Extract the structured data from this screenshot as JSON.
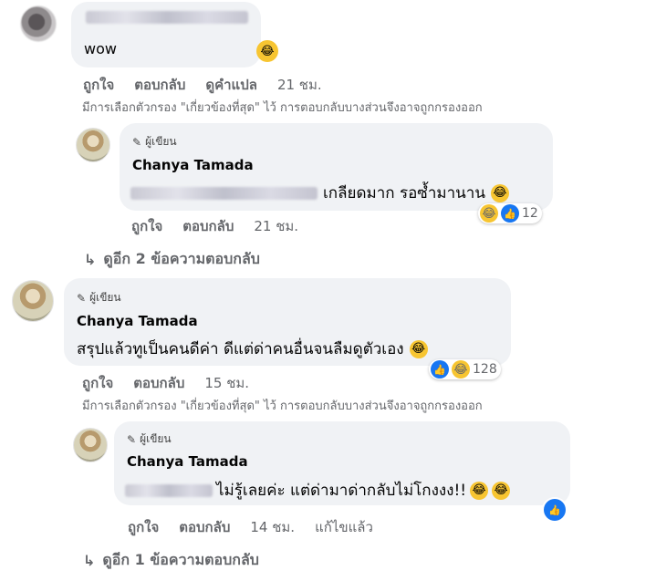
{
  "comment1": {
    "text": "wow",
    "emoji": "laugh-tears-emoji",
    "actions": {
      "like": "ถูกใจ",
      "reply": "ตอบกลับ",
      "translate": "ดูคำแปล",
      "time": "21 ชม."
    },
    "filter_note": "มีการเลือกตัวกรอง \"เกี่ยวข้องที่สุด\" ไว้ การตอบกลับบางส่วนจึงอาจถูกกรองออก"
  },
  "reply1": {
    "badge": "ผู้เขียน",
    "name": "Chanya Tamada",
    "text": "เกลียดมาก รอซ้ำมานาน",
    "actions": {
      "like": "ถูกใจ",
      "reply": "ตอบกลับ",
      "time": "21 ชม."
    },
    "reaction_count": "12"
  },
  "more_replies_1": "ดูอีก 2 ข้อความตอบกลับ",
  "comment2": {
    "badge": "ผู้เขียน",
    "name": "Chanya Tamada",
    "text": "สรุปแล้วทูเป็นคนดีค่า ดีแต่ด่าคนอื่นจนลืมดูตัวเอง",
    "actions": {
      "like": "ถูกใจ",
      "reply": "ตอบกลับ",
      "time": "15 ชม."
    },
    "reaction_count": "128",
    "filter_note": "มีการเลือกตัวกรอง \"เกี่ยวข้องที่สุด\" ไว้ การตอบกลับบางส่วนจึงอาจถูกกรองออก"
  },
  "reply2": {
    "badge": "ผู้เขียน",
    "name": "Chanya Tamada",
    "text": "ไม่รู้เลยค่ะ แต่ด่ามาด่ากลับไม่โกงงง!!",
    "actions": {
      "like": "ถูกใจ",
      "reply": "ตอบกลับ",
      "time": "14 ชม.",
      "edited": "แก้ไขแล้ว"
    }
  },
  "more_replies_2": "ดูอีก 1 ข้อความตอบกลับ",
  "icons": {
    "pencil": "✎",
    "reply_arrow": "↳",
    "laugh": "😂",
    "like": "👍"
  }
}
